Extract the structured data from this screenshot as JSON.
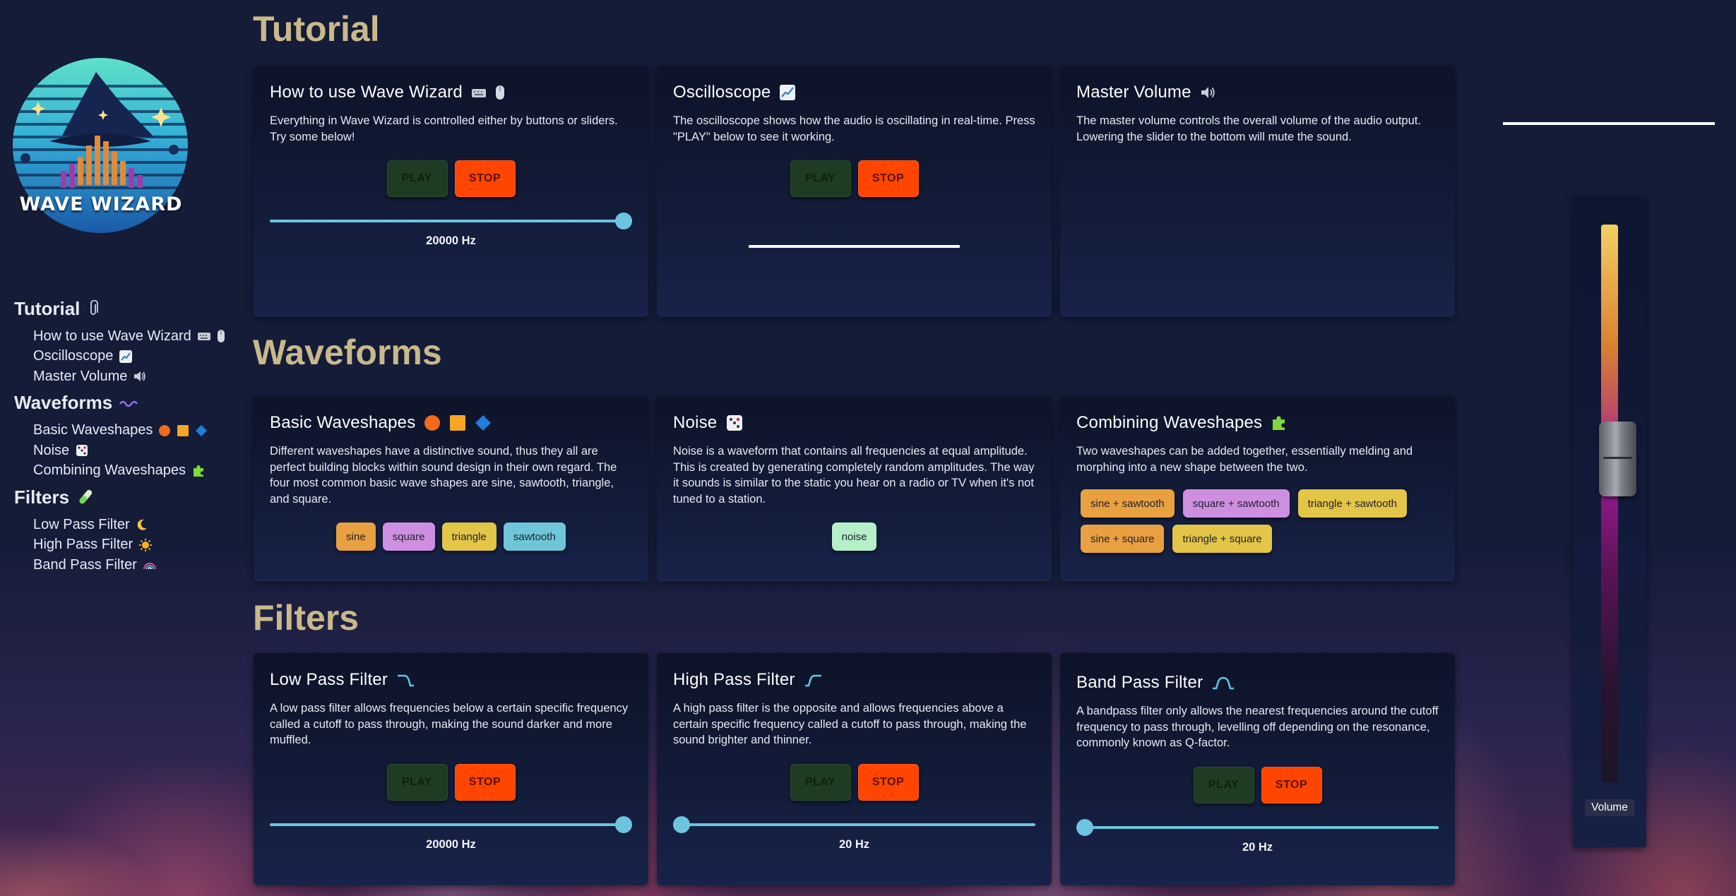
{
  "app": {
    "logo_text": "WAVE WIZARD"
  },
  "sidebar": {
    "sections": [
      {
        "title": "Tutorial",
        "icon": "paperclip-icon",
        "items": [
          {
            "label": "How to use Wave Wizard",
            "icons": [
              "keyboard-icon",
              "mouse-icon"
            ]
          },
          {
            "label": "Oscilloscope",
            "icons": [
              "chart-increasing-icon"
            ]
          },
          {
            "label": "Master Volume",
            "icons": [
              "speaker-icon"
            ]
          }
        ]
      },
      {
        "title": "Waveforms",
        "icon": "wavy-dash-icon",
        "items": [
          {
            "label": "Basic Waveshapes",
            "icons": [
              "orange-circle-icon",
              "orange-square-icon",
              "blue-diamond-icon"
            ]
          },
          {
            "label": "Noise",
            "icons": [
              "dice-icon"
            ]
          },
          {
            "label": "Combining Waveshapes",
            "icons": [
              "puzzle-piece-icon"
            ]
          }
        ]
      },
      {
        "title": "Filters",
        "icon": "test-tube-icon",
        "items": [
          {
            "label": "Low Pass Filter",
            "icons": [
              "crescent-moon-icon"
            ]
          },
          {
            "label": "High Pass Filter",
            "icons": [
              "sun-icon"
            ]
          },
          {
            "label": "Band Pass Filter",
            "icons": [
              "rainbow-icon"
            ]
          }
        ]
      }
    ]
  },
  "sections": {
    "tutorial": "Tutorial",
    "waveforms": "Waveforms",
    "filters": "Filters"
  },
  "buttons": {
    "play": "PLAY",
    "stop": "STOP"
  },
  "cards": {
    "how_to": {
      "title": "How to use Wave Wizard",
      "desc": "Everything in Wave Wizard is controlled either by buttons or sliders. Try some below!",
      "slider_value": "20000 Hz",
      "slider_fraction": 1.0
    },
    "oscilloscope": {
      "title": "Oscilloscope",
      "desc": "The oscilloscope shows how the audio is oscillating in real-time. Press \"PLAY\" below to see it working."
    },
    "master_volume": {
      "title": "Master Volume",
      "desc": "The master volume controls the overall volume of the audio output. Lowering the slider to the bottom will mute the sound."
    },
    "basic_waveshapes": {
      "title": "Basic Waveshapes",
      "desc": "Different waveshapes have a distinctive sound, thus they all are perfect building blocks within sound design in their own regard. The four most common basic wave shapes are sine, sawtooth, triangle, and square.",
      "pills": [
        {
          "label": "sine",
          "color": "#e9a040"
        },
        {
          "label": "square",
          "color": "#cf8fe0"
        },
        {
          "label": "triangle",
          "color": "#e3c548"
        },
        {
          "label": "sawtooth",
          "color": "#6fc6d8"
        }
      ]
    },
    "noise": {
      "title": "Noise",
      "desc": "Noise is a waveform that contains all frequencies at equal amplitude. This is created by generating completely random amplitudes. The way it sounds is similar to the static you hear on a radio or TV when it's not tuned to a station.",
      "pills": [
        {
          "label": "noise",
          "color": "#b6f0c8"
        }
      ]
    },
    "combining": {
      "title": "Combining Waveshapes",
      "desc": "Two waveshapes can be added together, essentially melding and morphing into a new shape between the two.",
      "pills": [
        {
          "label": "sine + sawtooth",
          "color": "#e9a040"
        },
        {
          "label": "square + sawtooth",
          "color": "#cf8fe0"
        },
        {
          "label": "triangle + sawtooth",
          "color": "#e3c548"
        },
        {
          "label": "sine + square",
          "color": "#e9a040"
        },
        {
          "label": "triangle + square",
          "color": "#e3c548"
        }
      ]
    },
    "low_pass": {
      "title": "Low Pass Filter",
      "desc": "A low pass filter allows frequencies below a certain specific frequency called a cutoff to pass through, making the sound darker and more muffled.",
      "slider_value": "20000 Hz",
      "slider_fraction": 1.0
    },
    "high_pass": {
      "title": "High Pass Filter",
      "desc": "A high pass filter is the opposite and allows frequencies above a certain specific frequency called a cutoff to pass through, making the sound brighter and thinner.",
      "slider_value": "20 Hz",
      "slider_fraction": 0.0
    },
    "band_pass": {
      "title": "Band Pass Filter",
      "desc": "A bandpass filter only allows the nearest frequencies around the cutoff frequency to pass through, levelling off depending on the resonance, commonly known as Q-factor.",
      "slider_value": "20 Hz",
      "slider_fraction": 0.0
    }
  },
  "volume": {
    "label": "Volume",
    "level_fraction": 0.58
  },
  "colors": {
    "accent": "#6cc4df",
    "section_title": "#c9b98a",
    "play": "#1f3b21",
    "stop": "#ff4500"
  }
}
